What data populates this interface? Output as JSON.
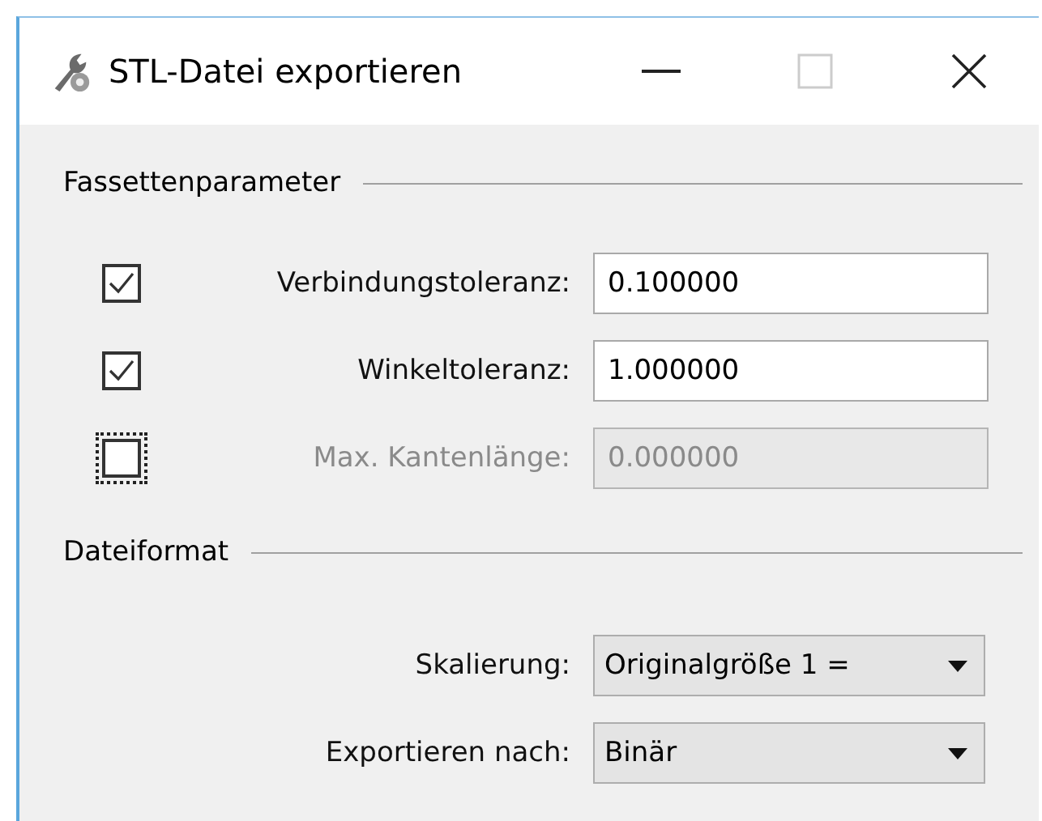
{
  "window": {
    "title": "STL-Datei exportieren"
  },
  "sections": [
    {
      "title": "Fassettenparameter",
      "kind": "fields",
      "rows": [
        {
          "label": "Verbindungstoleranz:",
          "checked": true,
          "disabled": false,
          "focused": false,
          "value": "0.100000"
        },
        {
          "label": "Winkeltoleranz:",
          "checked": true,
          "disabled": false,
          "focused": false,
          "value": "1.000000"
        },
        {
          "label": "Max. Kantenlänge:",
          "checked": false,
          "disabled": true,
          "focused": true,
          "value": "0.000000"
        }
      ]
    },
    {
      "title": "Dateiformat",
      "kind": "selects",
      "rows": [
        {
          "label": "Skalierung:",
          "value": "Originalgröße 1 ="
        },
        {
          "label": "Exportieren nach:",
          "value": "Binär"
        }
      ]
    }
  ]
}
